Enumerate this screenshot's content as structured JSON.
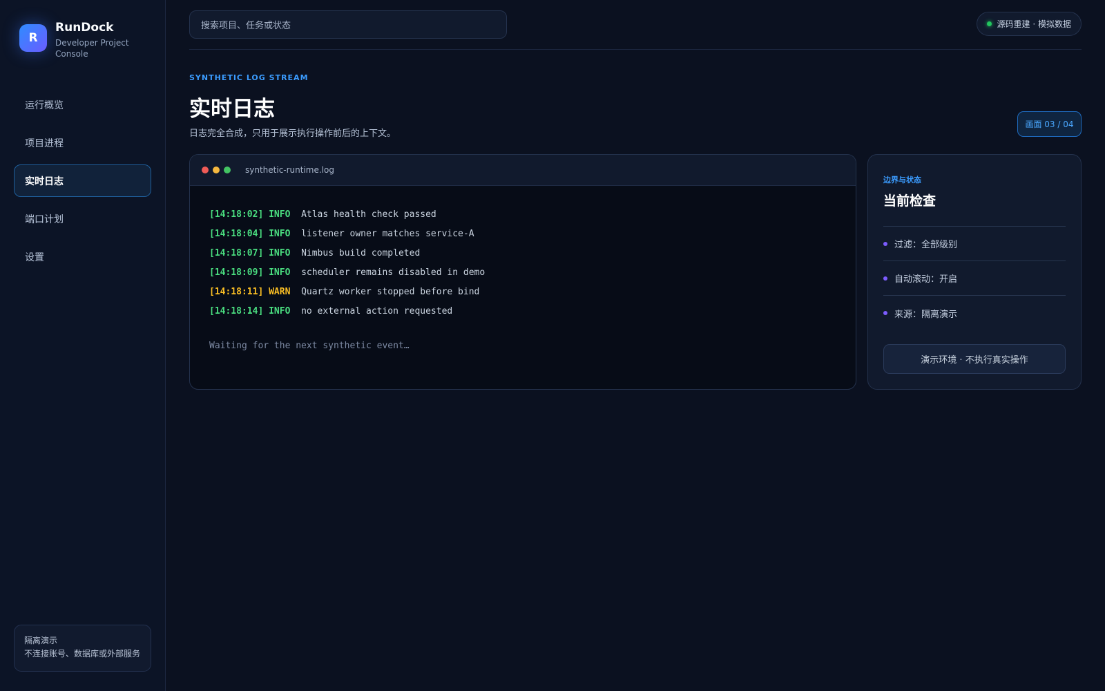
{
  "brand": {
    "logo_letter": "R",
    "name": "RunDock",
    "subtitle": "Developer Project Console"
  },
  "sidebar": {
    "items": [
      {
        "label": "运行概览",
        "active": false
      },
      {
        "label": "项目进程",
        "active": false
      },
      {
        "label": "实时日志",
        "active": true
      },
      {
        "label": "端口计划",
        "active": false
      },
      {
        "label": "设置",
        "active": false
      }
    ],
    "note": {
      "title": "隔离演示",
      "text": "不连接账号、数据库或外部服务"
    }
  },
  "topbar": {
    "search_placeholder": "搜索项目、任务或状态",
    "status_text": "源码重建 · 模拟数据"
  },
  "page": {
    "eyebrow": "SYNTHETIC LOG STREAM",
    "title": "实时日志",
    "subtitle": "日志完全合成，只用于展示执行操作前后的上下文。",
    "screen_badge": "画面 03 / 04"
  },
  "terminal": {
    "filename": "synthetic-runtime.log",
    "lines": [
      {
        "time": "[14:18:02]",
        "level": "INFO",
        "message": "Atlas health check passed"
      },
      {
        "time": "[14:18:04]",
        "level": "INFO",
        "message": "listener owner matches service-A"
      },
      {
        "time": "[14:18:07]",
        "level": "INFO",
        "message": "Nimbus build completed"
      },
      {
        "time": "[14:18:09]",
        "level": "INFO",
        "message": "scheduler remains disabled in demo"
      },
      {
        "time": "[14:18:11]",
        "level": "WARN",
        "message": "Quartz worker stopped before bind"
      },
      {
        "time": "[14:18:14]",
        "level": "INFO",
        "message": "no external action requested"
      }
    ],
    "waiting": "Waiting for the next synthetic event…"
  },
  "panel": {
    "eyebrow": "边界与状态",
    "title": "当前检查",
    "items": [
      {
        "label": "过滤：全部级别"
      },
      {
        "label": "自动滚动：开启"
      },
      {
        "label": "来源：隔离演示"
      }
    ],
    "button_label": "演示环境 · 不执行真实操作"
  },
  "colors": {
    "accent": "#3b9cff",
    "info": "#4ade80",
    "warn": "#fbbf24",
    "bullet": "#7c5cff",
    "status_ok": "#22c55e"
  }
}
